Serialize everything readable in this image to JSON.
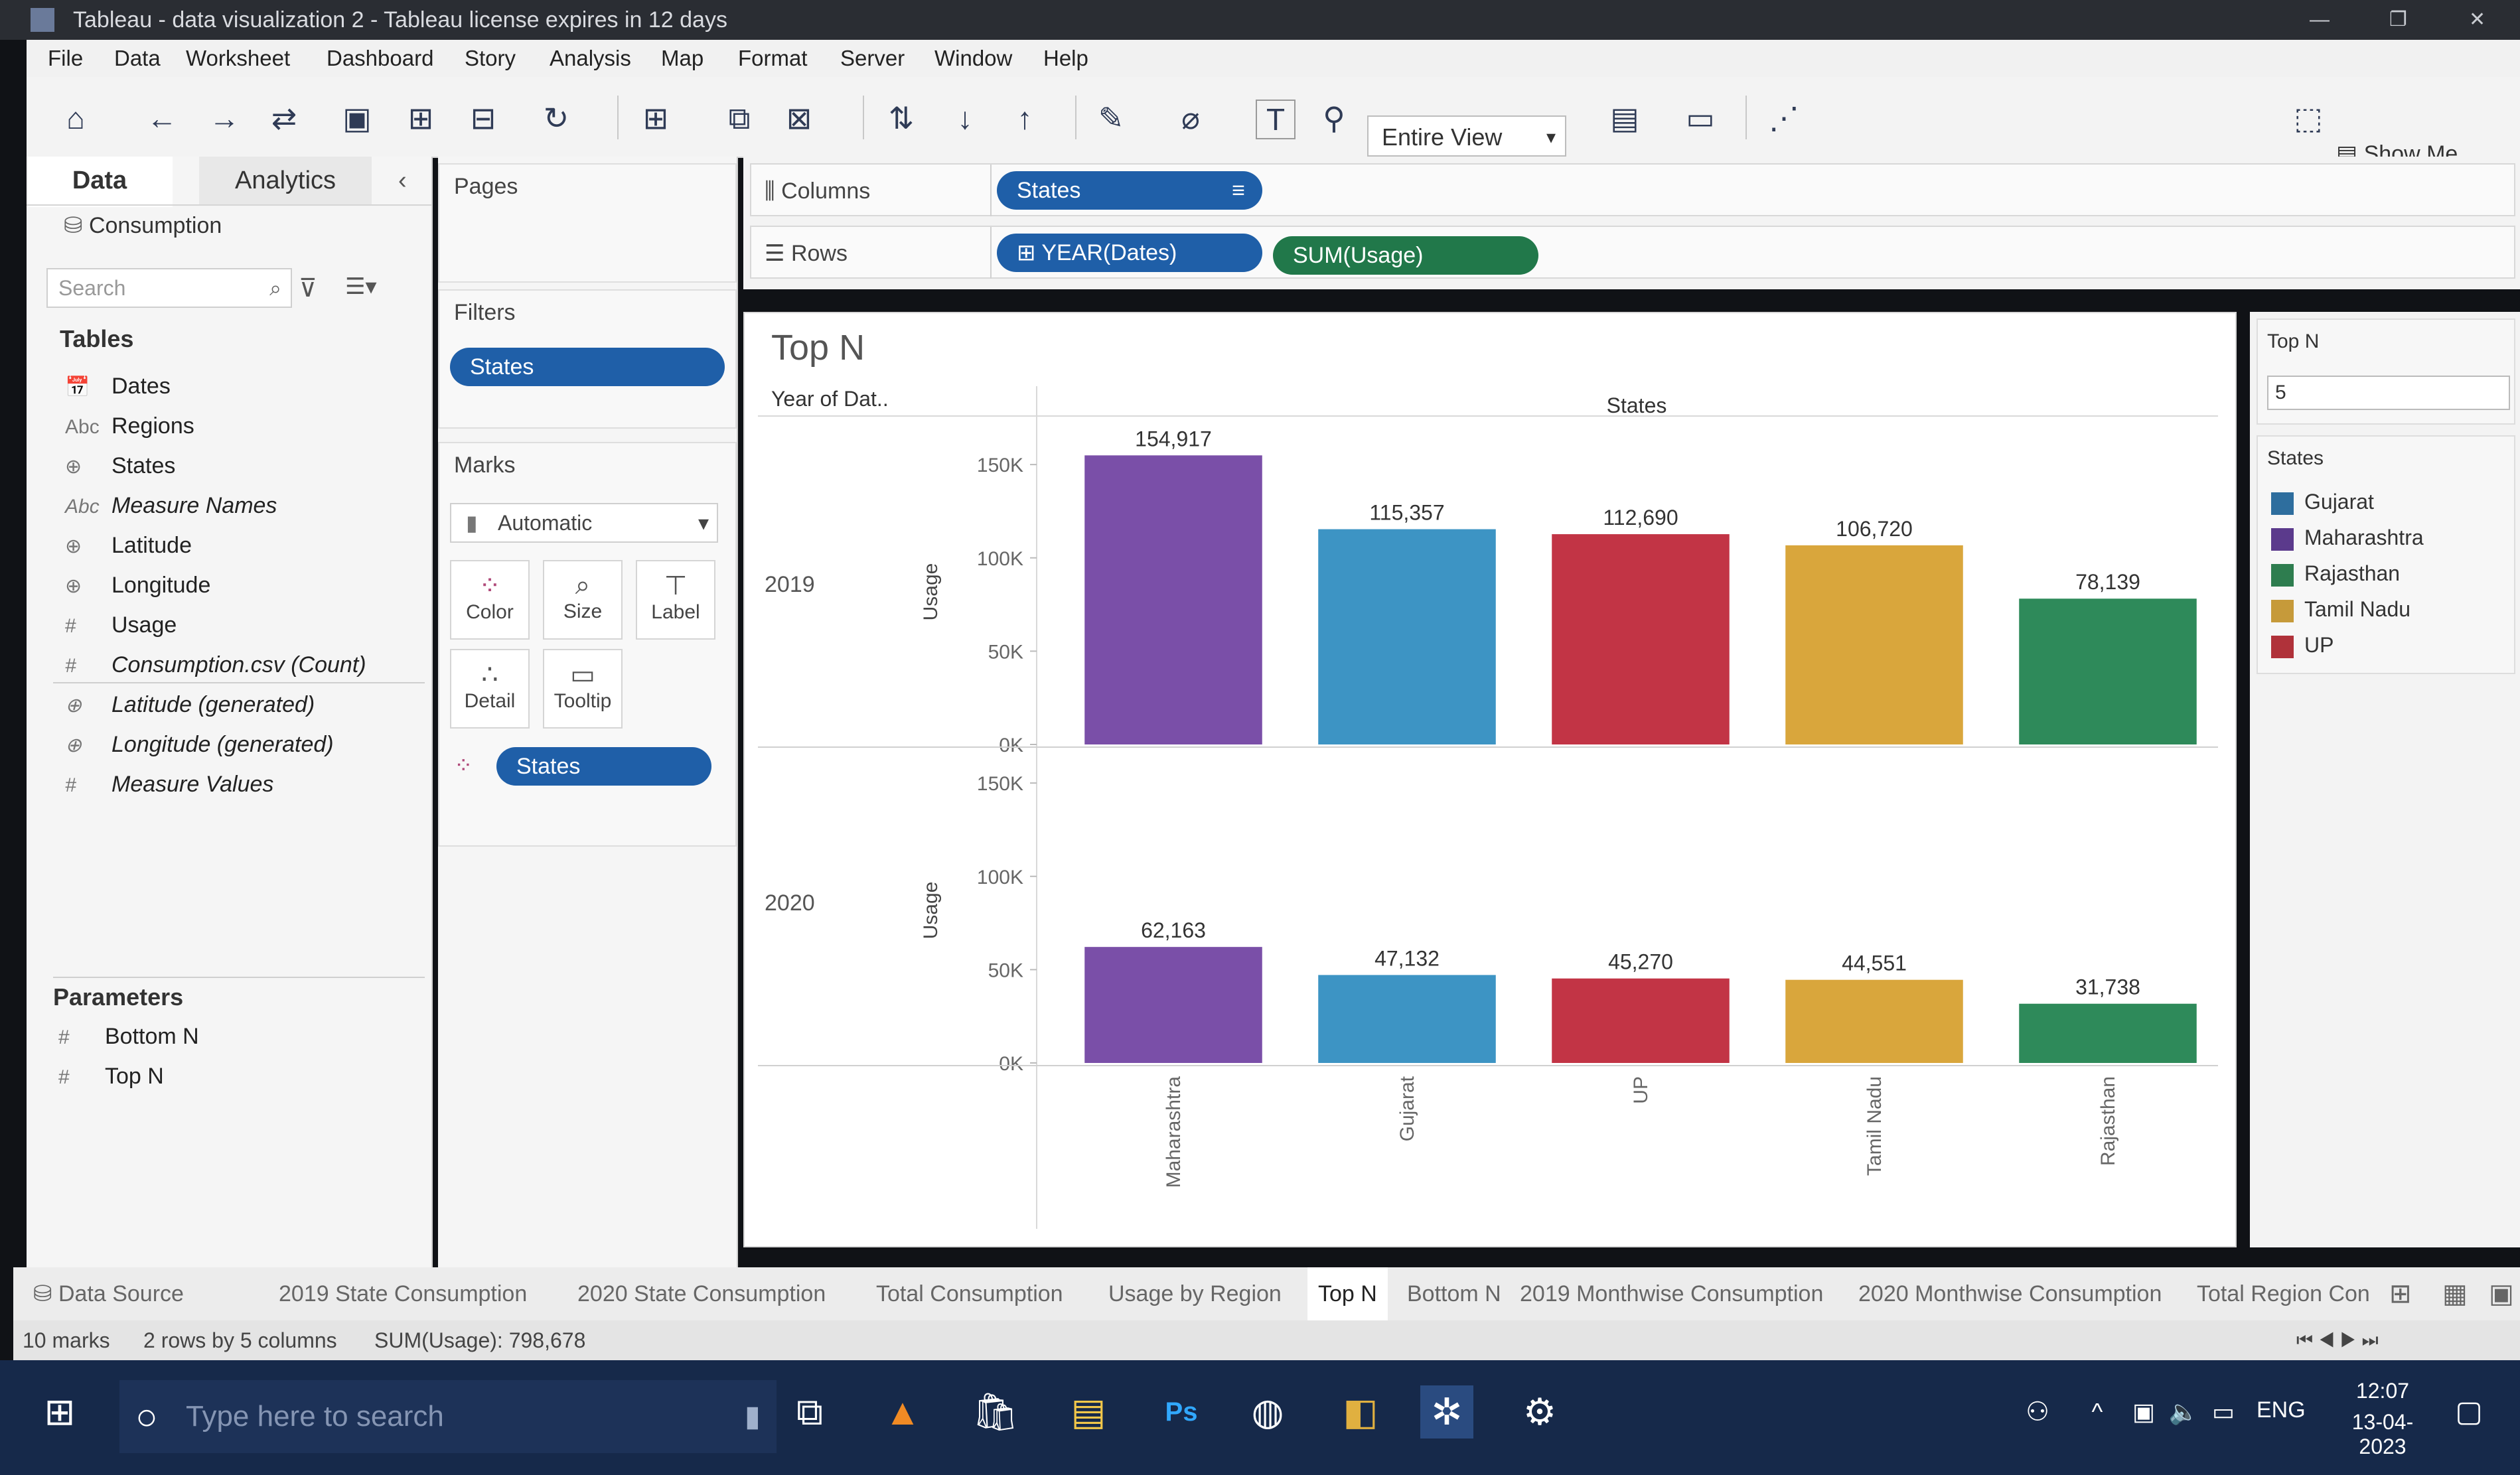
{
  "window": {
    "title": "Tableau - data visualization 2 - Tableau license expires in 12 days"
  },
  "menu": [
    "File",
    "Data",
    "Worksheet",
    "Dashboard",
    "Story",
    "Analysis",
    "Map",
    "Format",
    "Server",
    "Window",
    "Help"
  ],
  "toolbar": {
    "fit_mode": "Entire View",
    "show_me": "Show Me"
  },
  "data_pane": {
    "tab_data": "Data",
    "tab_analytics": "Analytics",
    "datasource": "Consumption",
    "search_placeholder": "Search",
    "tables_header": "Tables",
    "fields": [
      {
        "icon": "calendar-icon",
        "glyph": "📅",
        "label": "Dates",
        "italic": false
      },
      {
        "icon": "abc-icon",
        "glyph": "Abc",
        "label": "Regions",
        "italic": false
      },
      {
        "icon": "globe-icon",
        "glyph": "⊕",
        "label": "States",
        "italic": false
      },
      {
        "icon": "abc-icon",
        "glyph": "Abc",
        "label": "Measure Names",
        "italic": true
      },
      {
        "icon": "globe-icon",
        "glyph": "⊕",
        "label": "Latitude",
        "italic": false
      },
      {
        "icon": "globe-icon",
        "glyph": "⊕",
        "label": "Longitude",
        "italic": false
      },
      {
        "icon": "hash-icon",
        "glyph": "#",
        "label": "Usage",
        "italic": false
      },
      {
        "icon": "hash-icon",
        "glyph": "#",
        "label": "Consumption.csv (Count)",
        "italic": true
      },
      {
        "icon": "globe-icon",
        "glyph": "⊕",
        "label": "Latitude (generated)",
        "italic": true
      },
      {
        "icon": "globe-icon",
        "glyph": "⊕",
        "label": "Longitude (generated)",
        "italic": true
      },
      {
        "icon": "hash-icon",
        "glyph": "#",
        "label": "Measure Values",
        "italic": true
      }
    ],
    "parameters_header": "Parameters",
    "parameters": [
      "Bottom N",
      "Top N"
    ]
  },
  "cards": {
    "pages": "Pages",
    "filters": "Filters",
    "filter_pill": "States",
    "marks": "Marks",
    "mark_type": "Automatic",
    "buttons": [
      "Color",
      "Size",
      "Label",
      "Detail",
      "Tooltip"
    ],
    "marks_pill": "States"
  },
  "shelves": {
    "columns_label": "Columns",
    "columns_pill": "States",
    "rows_label": "Rows",
    "rows_pill_1": "YEAR(Dates)",
    "rows_pill_2": "SUM(Usage)"
  },
  "view": {
    "title": "Top N",
    "row_header": "Year of Dat..",
    "col_header": "States",
    "axis_label": "Usage"
  },
  "right_pane": {
    "param_title": "Top N",
    "param_value": "5",
    "legend_title": "States",
    "legend": [
      {
        "label": "Gujarat",
        "color": "#2e6e9e"
      },
      {
        "label": "Maharashtra",
        "color": "#5b3a8c"
      },
      {
        "label": "Rajasthan",
        "color": "#2e7d4f"
      },
      {
        "label": "Tamil Nadu",
        "color": "#c69a3a"
      },
      {
        "label": "UP",
        "color": "#b0323a"
      }
    ]
  },
  "sheet_tabs": {
    "data_source": "Data Source",
    "tabs": [
      "2019 State Consumption",
      "2020 State Consumption",
      "Total Consumption",
      "Usage by Region",
      "Top N",
      "Bottom N",
      "2019 Monthwise Consumption",
      "2020 Monthwise Consumption",
      "Total Region Con"
    ],
    "active": "Top N"
  },
  "status": {
    "marks": "10 marks",
    "dims": "2 rows by 5 columns",
    "sum": "SUM(Usage): 798,678"
  },
  "taskbar": {
    "search_placeholder": "Type here to search",
    "lang": "ENG",
    "time": "12:07",
    "date": "13-04-2023"
  },
  "chart_data": {
    "type": "bar",
    "categories": [
      "Maharashtra",
      "Gujarat",
      "UP",
      "Tamil Nadu",
      "Rajasthan"
    ],
    "colors": [
      "#7a4fa8",
      "#3d94c4",
      "#c23445",
      "#d9a63c",
      "#2e8a5a"
    ],
    "panes": [
      {
        "row": "2019",
        "values": [
          154917,
          115357,
          112690,
          106720,
          78139
        ],
        "labels": [
          "154,917",
          "115,357",
          "112,690",
          "106,720",
          "78,139"
        ]
      },
      {
        "row": "2020",
        "values": [
          62163,
          47132,
          45270,
          44551,
          31738
        ],
        "labels": [
          "62,163",
          "47,132",
          "45,270",
          "44,551",
          "31,738"
        ]
      }
    ],
    "ylabel": "Usage",
    "yticks": [
      "0K",
      "50K",
      "100K",
      "150K"
    ],
    "ylim": [
      0,
      160000
    ]
  }
}
